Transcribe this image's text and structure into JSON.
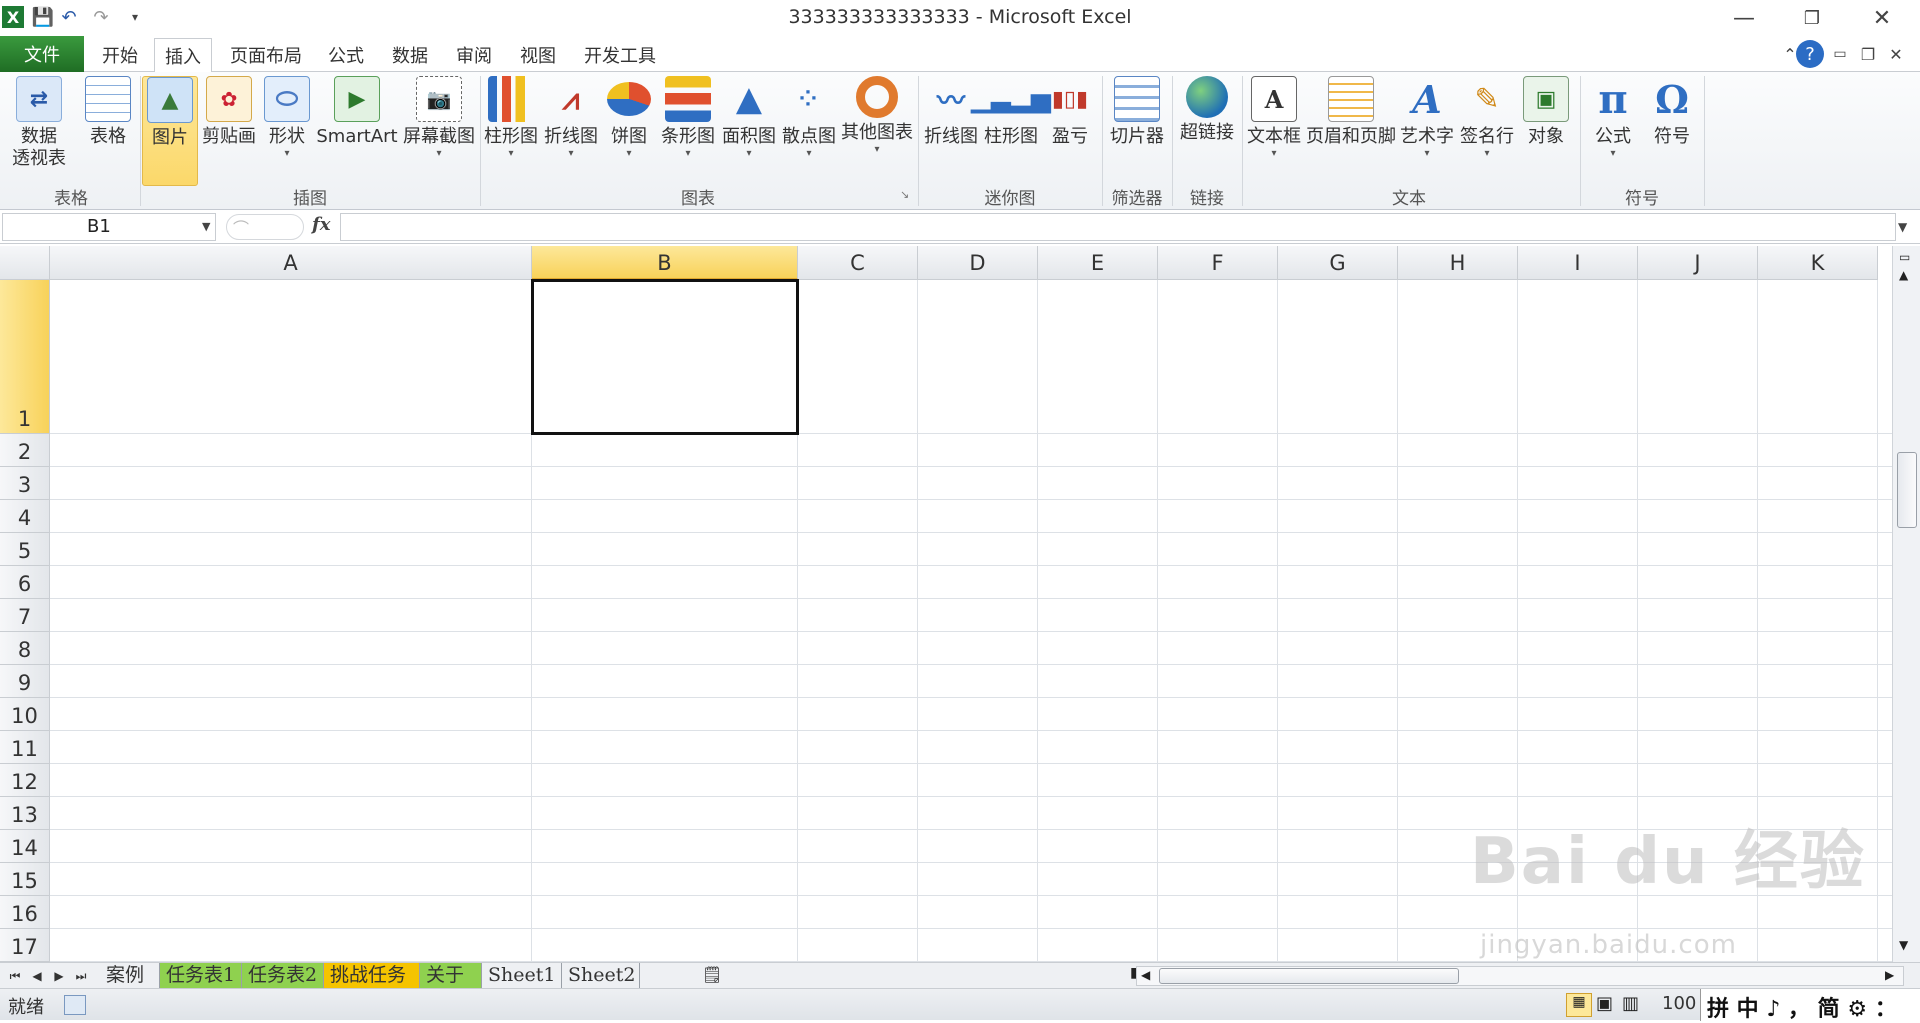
{
  "window": {
    "title": "333333333333333 - Microsoft Excel"
  },
  "tabs": [
    "文件",
    "开始",
    "插入",
    "页面布局",
    "公式",
    "数据",
    "审阅",
    "视图",
    "开发工具"
  ],
  "active_tab": "插入",
  "ribbon": {
    "groups": {
      "table": "表格",
      "illustrations": "插图",
      "charts": "图表",
      "sparklines": "迷你图",
      "filter": "筛选器",
      "links": "链接",
      "text": "文本",
      "symbols": "符号"
    },
    "buttons": {
      "pivot_line1": "数据",
      "pivot_line2": "透视表",
      "table": "表格",
      "picture": "图片",
      "clipart": "剪贴画",
      "shapes": "形状",
      "smartart": "SmartArt",
      "screenshot": "屏幕截图",
      "column_chart": "柱形图",
      "line_chart": "折线图",
      "pie_chart": "饼图",
      "bar_chart": "条形图",
      "area_chart": "面积图",
      "scatter_chart": "散点图",
      "other_charts": "其他图表",
      "spark_line": "折线图",
      "spark_column": "柱形图",
      "spark_winloss": "盈亏",
      "slicer": "切片器",
      "hyperlink": "超链接",
      "textbox": "文本框",
      "header_footer": "页眉和页脚",
      "wordart": "艺术字",
      "signature": "签名行",
      "object": "对象",
      "equation": "公式",
      "symbol": "符号"
    }
  },
  "formula_bar": {
    "name_box": "B1",
    "fx": "fx",
    "value": ""
  },
  "grid": {
    "columns": [
      "A",
      "B",
      "C",
      "D",
      "E",
      "F",
      "G",
      "H",
      "I",
      "J",
      "K"
    ],
    "rows": [
      "1",
      "2",
      "3",
      "4",
      "5",
      "6",
      "7",
      "8",
      "9",
      "10",
      "11",
      "12",
      "13",
      "14",
      "15",
      "16",
      "17"
    ],
    "selected_cell": "B1"
  },
  "sheets": [
    {
      "name": "案例",
      "color": ""
    },
    {
      "name": "任务表1",
      "color": "#8fd14f"
    },
    {
      "name": "任务表2",
      "color": "#8fd14f"
    },
    {
      "name": "挑战任务",
      "color": "#f5c400"
    },
    {
      "name": "关于",
      "color": "#8fd14f"
    },
    {
      "name": "Sheet1",
      "color": ""
    },
    {
      "name": "Sheet2",
      "color": ""
    }
  ],
  "status": {
    "ready": "就绪",
    "zoom": "100",
    "ime": "拼 中 ♪ ， 简 ⚙ ："
  },
  "watermark": {
    "brand": "Bai du 经验",
    "url": "jingyan.baidu.com"
  }
}
